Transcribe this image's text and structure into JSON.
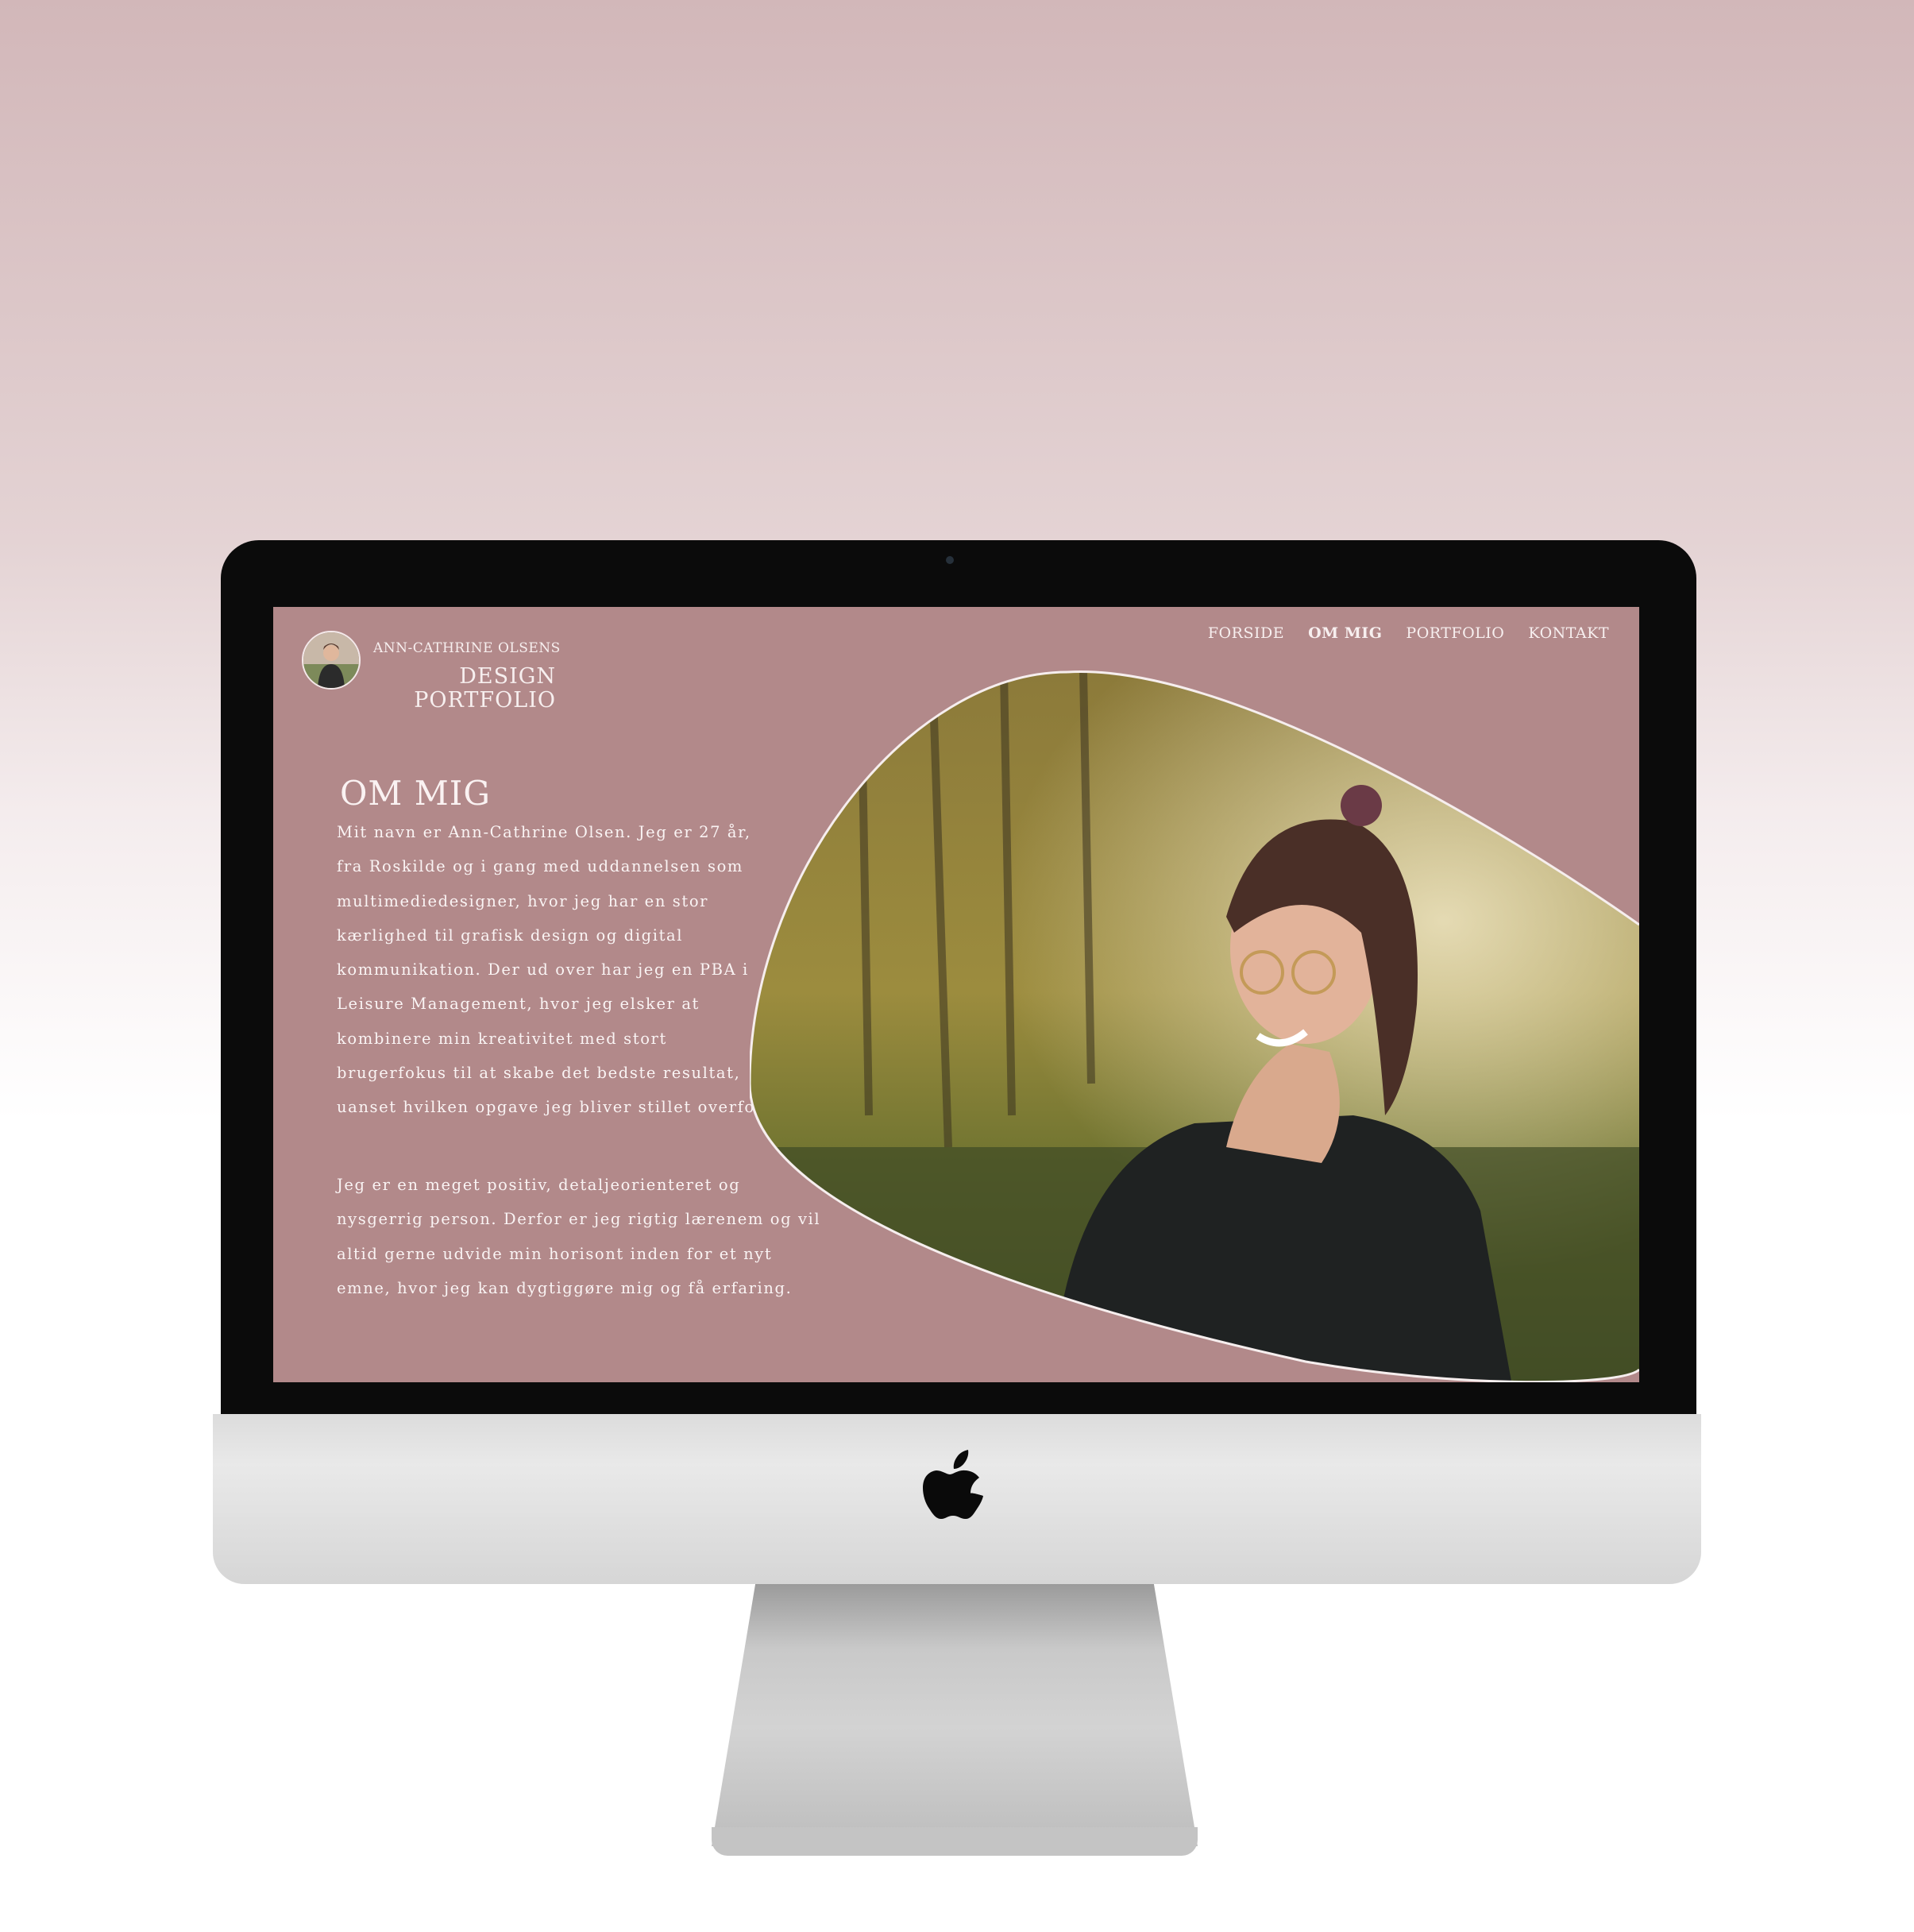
{
  "site": {
    "brand_name": "ANN-CATHRINE OLSENS",
    "brand_line1": "DESIGN",
    "brand_line2": "PORTFOLIO"
  },
  "nav": {
    "items": [
      {
        "label": "FORSIDE",
        "active": false
      },
      {
        "label": "OM MIG",
        "active": true
      },
      {
        "label": "PORTFOLIO",
        "active": false
      },
      {
        "label": "KONTAKT",
        "active": false
      }
    ]
  },
  "main": {
    "heading": "OM MIG",
    "paragraph1": "Mit navn er Ann-Cathrine Olsen. Jeg er 27 år, fra Roskilde og i gang med uddannelsen som multimediedesigner, hvor jeg har en stor kærlighed til grafisk design og digital kommunikation. Der ud over har jeg en PBA i Leisure Management, hvor jeg elsker at kombinere min kreativitet med stort brugerfokus til at skabe det bedste resultat, uanset hvilken opgave jeg bliver stillet overfor.",
    "paragraph2": "Jeg er en meget positiv, detaljeorienteret og nysgerrig person. Derfor er jeg rigtig lærenem og vil altid gerne udvide min horisont inden for et nyt emne, hvor jeg kan dygtiggøre mig og få erfaring."
  },
  "icons": {
    "brand_avatar": "avatar-photo",
    "device_logo": "apple-logo-icon"
  },
  "colors": {
    "site_background": "#b2898a",
    "text": "#faf4f4",
    "page_background_top": "#d2b7b9"
  }
}
